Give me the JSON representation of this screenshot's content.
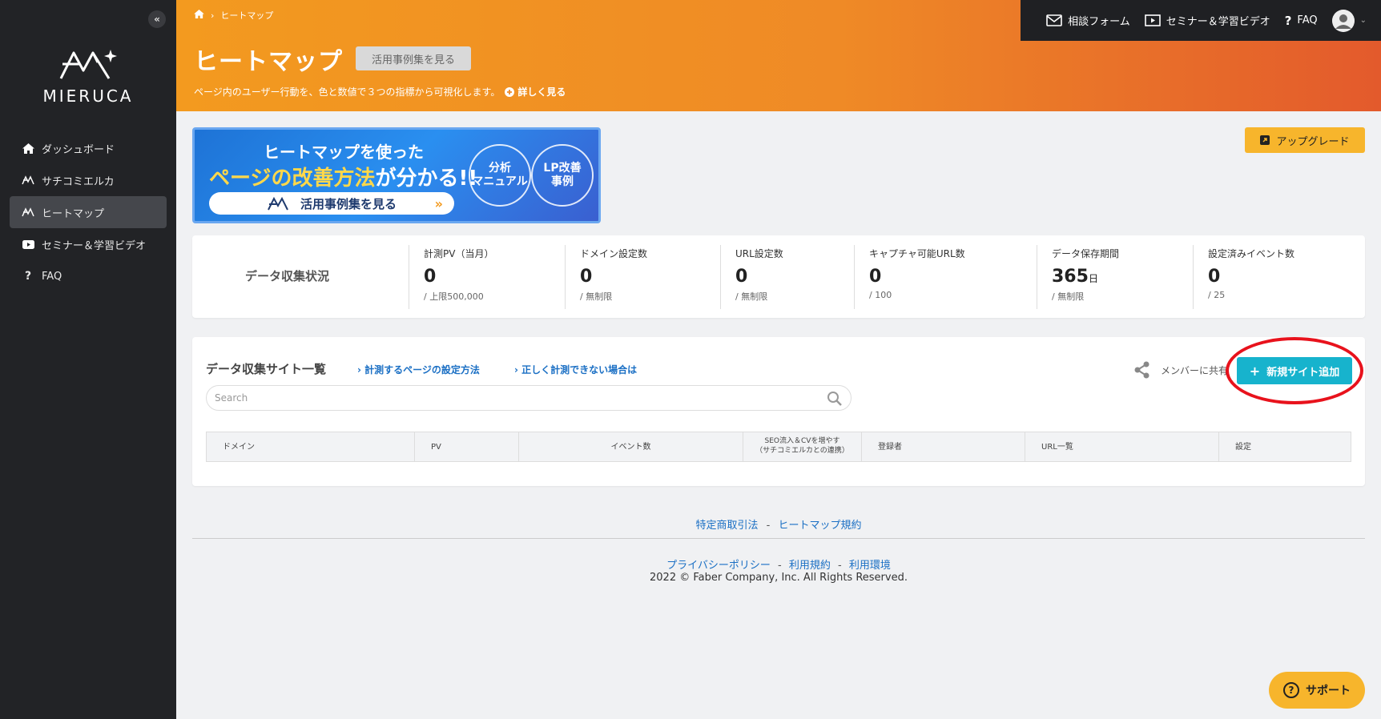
{
  "sidebar": {
    "collapse": "«",
    "logo_text": "MIERUCA",
    "items": [
      {
        "label": "ダッシュボード",
        "icon": "home-icon"
      },
      {
        "label": "サチコミエルカ",
        "icon": "mieruca-icon"
      },
      {
        "label": "ヒートマップ",
        "icon": "mieruca-icon",
        "active": true
      },
      {
        "label": "セミナー＆学習ビデオ",
        "icon": "youtube-icon"
      },
      {
        "label": "FAQ",
        "icon": "question-icon"
      }
    ]
  },
  "header": {
    "breadcrumb_current": "ヒートマップ",
    "title": "ヒートマップ",
    "examples_button": "活用事例集を見る",
    "subtitle": "ページ内のユーザー行動を、色と数値で３つの指標から可視化します。",
    "more_link": "詳しく見る",
    "topbar": {
      "contact": "相談フォーム",
      "seminar": "セミナー＆学習ビデオ",
      "faq": "FAQ"
    }
  },
  "banner": {
    "line1": "ヒートマップを使った",
    "line2_a": "ページの改善方法",
    "line2_b": "が分かる!!",
    "pill": "活用事例集を見る",
    "circle1": "分析\nマニュアル",
    "circle2": "LP改善\n事例"
  },
  "upgrade_button": "アップグレード",
  "stats": {
    "title": "データ収集状況",
    "items": [
      {
        "label": "計測PV（当月）",
        "value": "0",
        "unit": "",
        "sub": "/ 上限500,000"
      },
      {
        "label": "ドメイン設定数",
        "value": "0",
        "unit": "",
        "sub": "/ 無制限"
      },
      {
        "label": "URL設定数",
        "value": "0",
        "unit": "",
        "sub": "/ 無制限"
      },
      {
        "label": "キャプチャ可能URL数",
        "value": "0",
        "unit": "",
        "sub": "/ 100"
      },
      {
        "label": "データ保存期間",
        "value": "365",
        "unit": "日",
        "sub": "/ 無制限"
      },
      {
        "label": "設定済みイベント数",
        "value": "0",
        "unit": "",
        "sub": "/ 25"
      }
    ]
  },
  "sites": {
    "title": "データ収集サイト一覧",
    "link1": "計測するページの設定方法",
    "link2": "正しく計測できない場合は",
    "share_label": "メンバーに共有",
    "add_button": "新規サイト追加",
    "search_placeholder": "Search",
    "columns": [
      "ドメイン",
      "PV",
      "イベント数",
      "SEO流入＆CVを増やす\n（サチコミエルカとの連携）",
      "登録者",
      "URL一覧",
      "設定"
    ]
  },
  "footer": {
    "link_a": "特定商取引法",
    "link_b": "ヒートマップ規約",
    "link_c": "プライバシーポリシー",
    "link_d": "利用規約",
    "link_e": "利用環境",
    "sep": "-",
    "copyright": "2022 © Faber Company, Inc. All Rights Reserved."
  },
  "support_button": "サポート",
  "colors": {
    "accent_orange": "#f39a1f",
    "sidebar_bg": "#222326",
    "add_button": "#17b3cd",
    "upgrade": "#f7b52c",
    "highlight_circle": "#e8121c"
  }
}
